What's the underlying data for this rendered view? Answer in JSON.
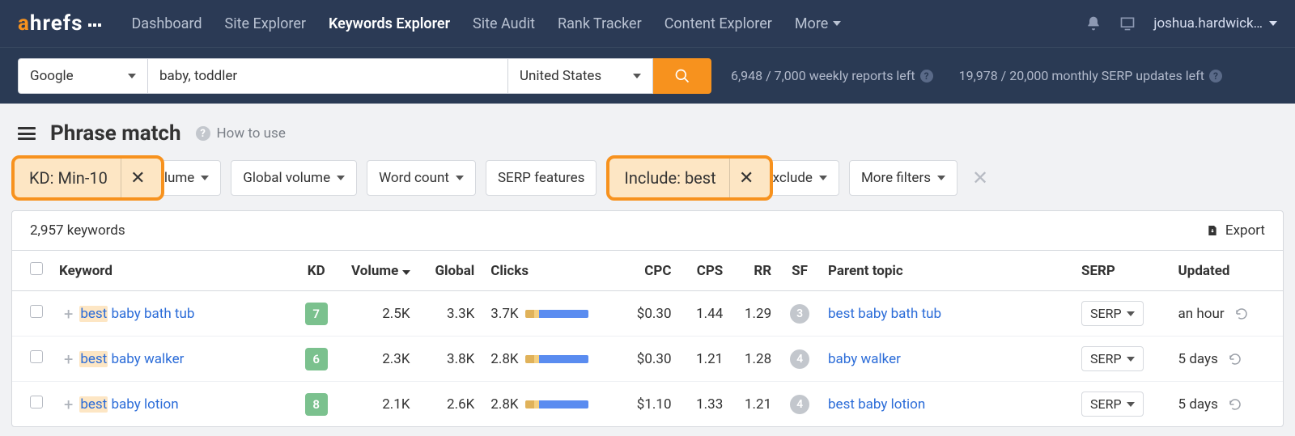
{
  "nav": {
    "items": [
      "Dashboard",
      "Site Explorer",
      "Keywords Explorer",
      "Site Audit",
      "Rank Tracker",
      "Content Explorer"
    ],
    "active_index": 2,
    "more": "More",
    "user": "joshua.hardwick…"
  },
  "search": {
    "engine": "Google",
    "keywords": "baby, toddler",
    "country": "United States",
    "status_reports": "6,948 / 7,000 weekly reports left",
    "status_serp": "19,978 / 20,000 monthly SERP updates left"
  },
  "page": {
    "title": "Phrase match",
    "how_to_use": "How to use"
  },
  "filters": {
    "kd_highlight": "KD: Min-10",
    "volume_trunc": "lume",
    "global_volume": "Global volume",
    "word_count": "Word count",
    "serp_features": "SERP features",
    "include_highlight": "Include: best",
    "exclude_trunc": "xclude",
    "more_filters": "More filters"
  },
  "results": {
    "count_label": "2,957 keywords",
    "export": "Export"
  },
  "columns": {
    "keyword": "Keyword",
    "kd": "KD",
    "volume": "Volume",
    "global": "Global",
    "clicks": "Clicks",
    "cpc": "CPC",
    "cps": "CPS",
    "rr": "RR",
    "sf": "SF",
    "parent": "Parent topic",
    "serp": "SERP",
    "updated": "Updated"
  },
  "serp_btn_label": "SERP",
  "rows": [
    {
      "best": "best",
      "rest": " baby bath tub",
      "kd": "7",
      "volume": "2.5K",
      "global": "3.3K",
      "clicks": "3.7K",
      "cpc": "$0.30",
      "cps": "1.44",
      "rr": "1.29",
      "sf": "3",
      "parent": "best baby bath tub",
      "updated": "an hour"
    },
    {
      "best": "best",
      "rest": " baby walker",
      "kd": "6",
      "volume": "2.3K",
      "global": "3.8K",
      "clicks": "2.8K",
      "cpc": "$0.30",
      "cps": "1.21",
      "rr": "1.28",
      "sf": "4",
      "parent": "baby walker",
      "updated": "5 days"
    },
    {
      "best": "best",
      "rest": " baby lotion",
      "kd": "8",
      "volume": "2.1K",
      "global": "2.6K",
      "clicks": "2.8K",
      "cpc": "$1.10",
      "cps": "1.33",
      "rr": "1.21",
      "sf": "4",
      "parent": "best baby lotion",
      "updated": "5 days"
    }
  ]
}
